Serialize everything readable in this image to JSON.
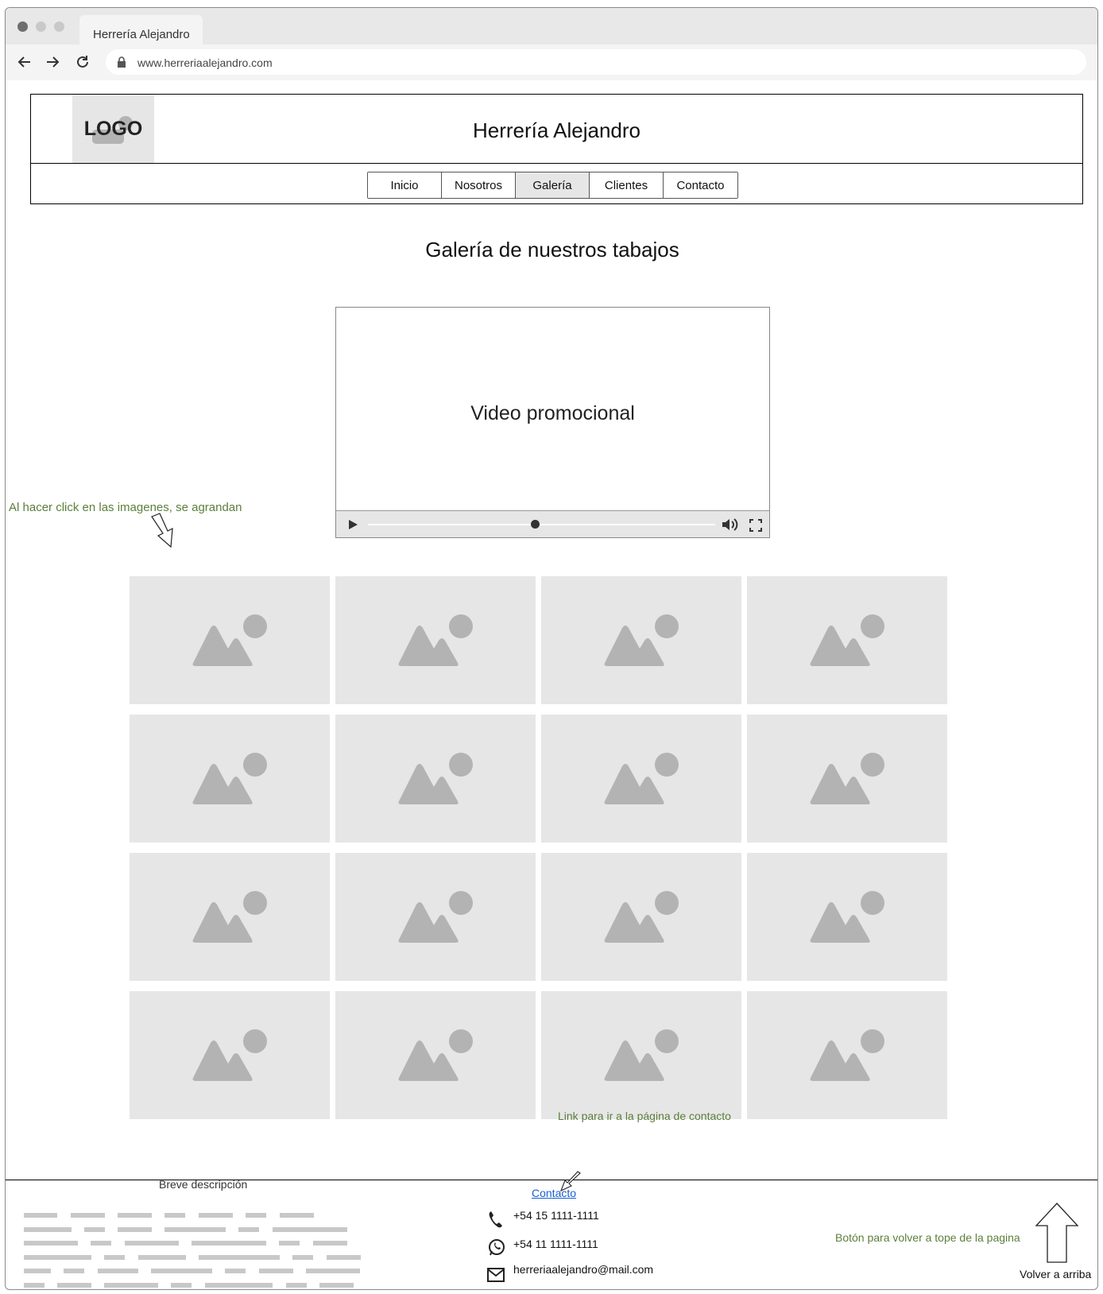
{
  "browser": {
    "tab_title": "Herrería Alejandro",
    "url": "www.herreriaalejandro.com"
  },
  "header": {
    "logo_text": "LOGO",
    "site_title": "Herrería Alejandro",
    "nav": [
      {
        "label": "Inicio",
        "active": false
      },
      {
        "label": "Nosotros",
        "active": false
      },
      {
        "label": "Galería",
        "active": true
      },
      {
        "label": "Clientes",
        "active": false
      },
      {
        "label": "Contacto",
        "active": false
      }
    ]
  },
  "main": {
    "gallery_title": "Galería de nuestros tabajos",
    "video": {
      "label": "Video promocional",
      "progress": 0.48
    },
    "annotation_images": "Al hacer click en las imagenes, se agrandan",
    "image_count": 16,
    "image_icon": "image-placeholder-icon"
  },
  "footer": {
    "description_label": "Breve descripción",
    "annotation_contact": "Link para ir a la página de contacto",
    "contact_link": "Contacto",
    "phone": "+54 15 1111-1111",
    "whatsapp": "+54 11 1111-1111",
    "email": "herreriaalejandro@mail.com",
    "annotation_top": "Botón para volver a tope de la pagina",
    "back_to_top_label": "Volver a arriba"
  },
  "colors": {
    "annotation": "#5b7f3b",
    "placeholder_bg": "#e6e6e6",
    "placeholder_icon": "#b3b3b3",
    "link": "#1a5fd0"
  }
}
